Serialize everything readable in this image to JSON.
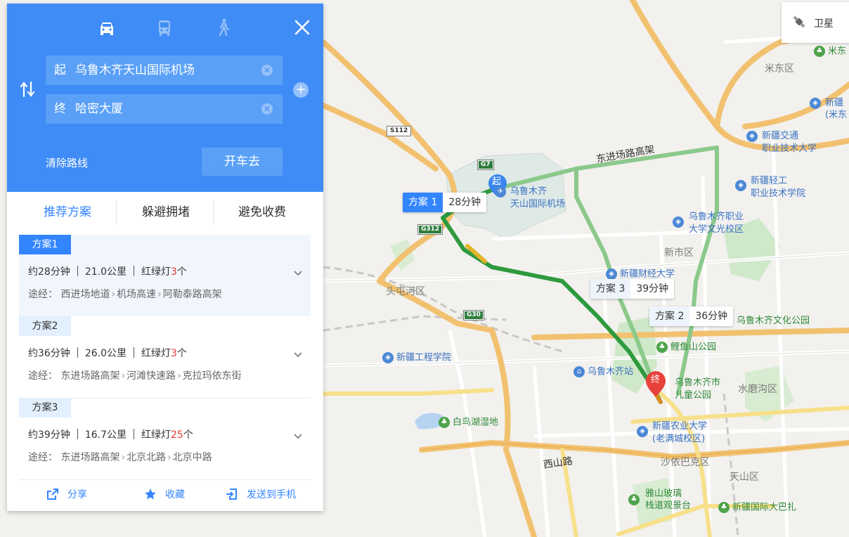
{
  "top": {
    "close_icon": "close-icon",
    "start_key": "起",
    "start_value": "乌鲁木齐天山国际机场",
    "end_key": "终",
    "end_value": "哈密大厦",
    "clear_label": "清除路线",
    "go_label": "开车去"
  },
  "tabs": [
    "推荐方案",
    "躲避拥堵",
    "避免收费"
  ],
  "plans": [
    {
      "badge": "方案1",
      "time": "约28分钟",
      "dist": "21.0公里",
      "lights_prefix": "红绿灯",
      "lights": "3",
      "lights_suffix": "个",
      "via_label": "途经：",
      "via": [
        "西进场地道",
        "机场高速",
        "阿勒泰路高架"
      ]
    },
    {
      "badge": "方案2",
      "time": "约36分钟",
      "dist": "26.0公里",
      "lights_prefix": "红绿灯",
      "lights": "3",
      "lights_suffix": "个",
      "via_label": "途经：",
      "via": [
        "东进场路高架",
        "河滩快速路",
        "克拉玛依东街"
      ]
    },
    {
      "badge": "方案3",
      "time": "约39分钟",
      "dist": "16.7公里",
      "lights_prefix": "红绿灯",
      "lights": "25",
      "lights_suffix": "个",
      "via_label": "途经：",
      "via": [
        "东进场路高架",
        "北京北路",
        "北京中路"
      ]
    }
  ],
  "actions": {
    "share": "分享",
    "favorite": "收藏",
    "send": "发送到手机"
  },
  "satellite": "卫星",
  "map": {
    "route_tags": [
      {
        "name": "方案 1",
        "time": "28分钟"
      },
      {
        "name": "方案 3",
        "time": "39分钟"
      },
      {
        "name": "方案 2",
        "time": "36分钟"
      }
    ],
    "markers": {
      "start": "起",
      "end": "终"
    },
    "shields": [
      "G7",
      "S112",
      "G312",
      "G30"
    ],
    "districts": [
      "米东区",
      "新市区",
      "头屯河区",
      "水磨沟区",
      "沙依巴克区",
      "天山区"
    ],
    "roads": [
      "东进场路高架",
      "西山路"
    ],
    "pois": {
      "airport": "乌鲁木齐\n天山国际机场",
      "midong_poi": "米东",
      "xinjiang_zhongyang": "新疆",
      "xinjiang_zhongyang2": "(米东",
      "jiaotong1": "新疆交通",
      "jiaotong2": "职业技术大学",
      "qinggong1": "新疆轻工",
      "qinggong2": "职业技术学院",
      "zhiye1": "乌鲁木齐职业",
      "zhiye2": "大学文光校区",
      "caijing": "新疆财经大学",
      "wenhua": "乌鲁木齐文化公园",
      "liyushan": "鲤鱼山公园",
      "gongcheng": "新疆工程学院",
      "station": "乌鲁木齐站",
      "ertong1": "乌鲁木齐市",
      "ertong2": "儿童公园",
      "bainiao": "白鸟湖湿地",
      "nongye1": "新疆农业大学",
      "nongye2": "(老满城校区)",
      "yashan1": "雅山玻璃",
      "yashan2": "栈道观景台",
      "dabazha": "新疆国际大巴扎"
    }
  },
  "colors": {
    "panel_blue": "#3f8cf6",
    "accent": "#3385ff",
    "route_green": "#2e9a3e",
    "red_marker": "#e8413b"
  }
}
